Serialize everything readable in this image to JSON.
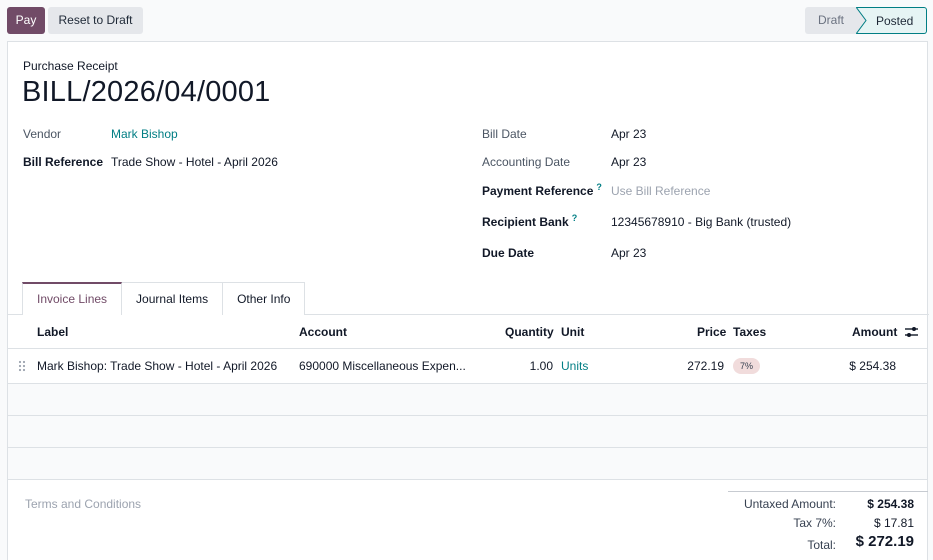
{
  "toolbar": {
    "pay_label": "Pay",
    "reset_label": "Reset to Draft"
  },
  "status": {
    "stages": [
      "Draft",
      "Posted"
    ],
    "current": "Posted"
  },
  "record": {
    "type": "Purchase Receipt",
    "name": "BILL/2026/04/0001"
  },
  "fields": {
    "vendor_label": "Vendor",
    "vendor_value": "Mark Bishop",
    "bill_ref_label": "Bill Reference",
    "bill_ref_value": "Trade Show - Hotel - April 2026",
    "bill_date_label": "Bill Date",
    "bill_date_value": "Apr 23",
    "acc_date_label": "Accounting Date",
    "acc_date_value": "Apr 23",
    "pay_ref_label": "Payment Reference",
    "pay_ref_help": "?",
    "pay_ref_placeholder": "Use Bill Reference",
    "bank_label": "Recipient Bank",
    "bank_help": "?",
    "bank_value": "12345678910 - Big Bank (trusted)",
    "due_label": "Due Date",
    "due_value": "Apr 23"
  },
  "tabs": [
    "Invoice Lines",
    "Journal Items",
    "Other Info"
  ],
  "lines": {
    "headers": {
      "label": "Label",
      "account": "Account",
      "quantity": "Quantity",
      "unit": "Unit",
      "price": "Price",
      "taxes": "Taxes",
      "amount": "Amount"
    },
    "rows": [
      {
        "label": "Mark Bishop: Trade Show - Hotel - April 2026",
        "account": "690000 Miscellaneous Expen...",
        "quantity": "1.00",
        "unit": "Units",
        "price": "272.19",
        "tax": "7%",
        "amount": "$ 254.38"
      }
    ]
  },
  "footer": {
    "terms_placeholder": "Terms and Conditions",
    "untaxed_label": "Untaxed Amount:",
    "untaxed_value": "$ 254.38",
    "tax_label": "Tax 7%:",
    "tax_value": "$ 17.81",
    "total_label": "Total:",
    "total_value": "$ 272.19"
  },
  "colors": {
    "brand": "#714B67",
    "link": "#017e84"
  }
}
